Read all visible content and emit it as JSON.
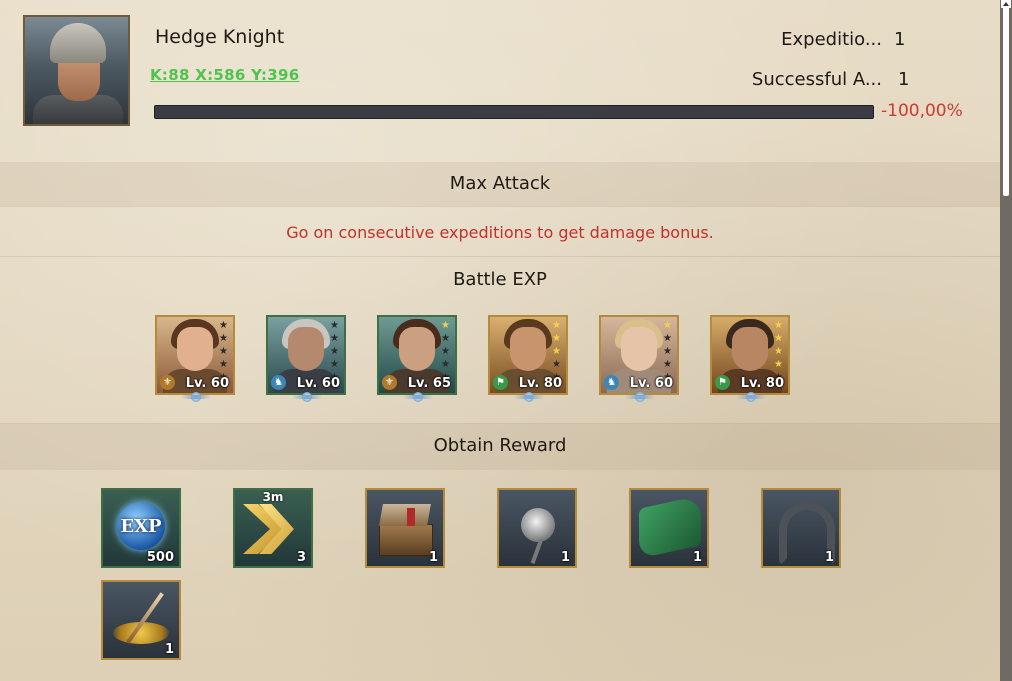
{
  "player": {
    "name": "Hedge Knight",
    "coords": "K:88 X:586 Y:396",
    "stats": [
      {
        "label": "Expeditio...",
        "value": "1"
      },
      {
        "label": "Successful A...",
        "value": "1"
      }
    ],
    "progress_fraction": 1.0,
    "progress_pct": "-100,00%"
  },
  "sections": {
    "max_attack": "Max Attack",
    "hint": "Go on consecutive expeditions to get damage bonus.",
    "battle_exp": "Battle EXP",
    "obtain_reward": "Obtain Reward"
  },
  "heroes": [
    {
      "level": "Lv. 60",
      "stars": 0,
      "class_icon": "shield-icon",
      "class_color": "#b07a2c",
      "frame": "gold"
    },
    {
      "level": "Lv. 60",
      "stars": 0,
      "class_icon": "horse-icon",
      "class_color": "#3a88b8",
      "frame": "green"
    },
    {
      "level": "Lv. 65",
      "stars": 1,
      "class_icon": "shield-icon",
      "class_color": "#b07a2c",
      "frame": "green"
    },
    {
      "level": "Lv. 80",
      "stars": 3,
      "class_icon": "bow-icon",
      "class_color": "#3a9a4a",
      "frame": "gold"
    },
    {
      "level": "Lv. 60",
      "stars": 1,
      "class_icon": "horse-icon",
      "class_color": "#3a88b8",
      "frame": "gold"
    },
    {
      "level": "Lv. 80",
      "stars": 4,
      "class_icon": "bow-icon",
      "class_color": "#3a9a4a",
      "frame": "gold"
    }
  ],
  "rewards": [
    {
      "icon": "exp-orb-icon",
      "qty": "500",
      "timer": "",
      "frame": "green"
    },
    {
      "icon": "speedup-arrows-icon",
      "qty": "3",
      "timer": "3m",
      "frame": "green"
    },
    {
      "icon": "treasure-chest-icon",
      "qty": "1",
      "timer": "",
      "frame": "gold"
    },
    {
      "icon": "silver-rose-icon",
      "qty": "1",
      "timer": "",
      "frame": "gold"
    },
    {
      "icon": "green-cloth-icon",
      "qty": "1",
      "timer": "",
      "frame": "gold"
    },
    {
      "icon": "horseshoe-icon",
      "qty": "1",
      "timer": "",
      "frame": "gold"
    },
    {
      "icon": "gold-quill-icon",
      "qty": "1",
      "timer": "",
      "frame": "gold"
    }
  ]
}
